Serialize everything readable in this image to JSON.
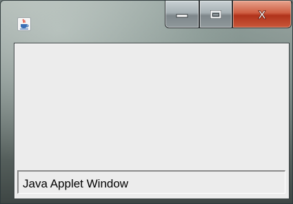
{
  "window": {
    "app_icon": "java-coffee-cup-icon",
    "controls": {
      "minimize_icon": "minimize-icon",
      "maximize_icon": "maximize-icon",
      "close_icon": "close-icon",
      "close_glyph": "X"
    },
    "status_text": "Java Applet Window",
    "colors": {
      "client_background": "#ececec",
      "close_button": "#c9472b",
      "frame_glass": "#7f8b88"
    }
  }
}
